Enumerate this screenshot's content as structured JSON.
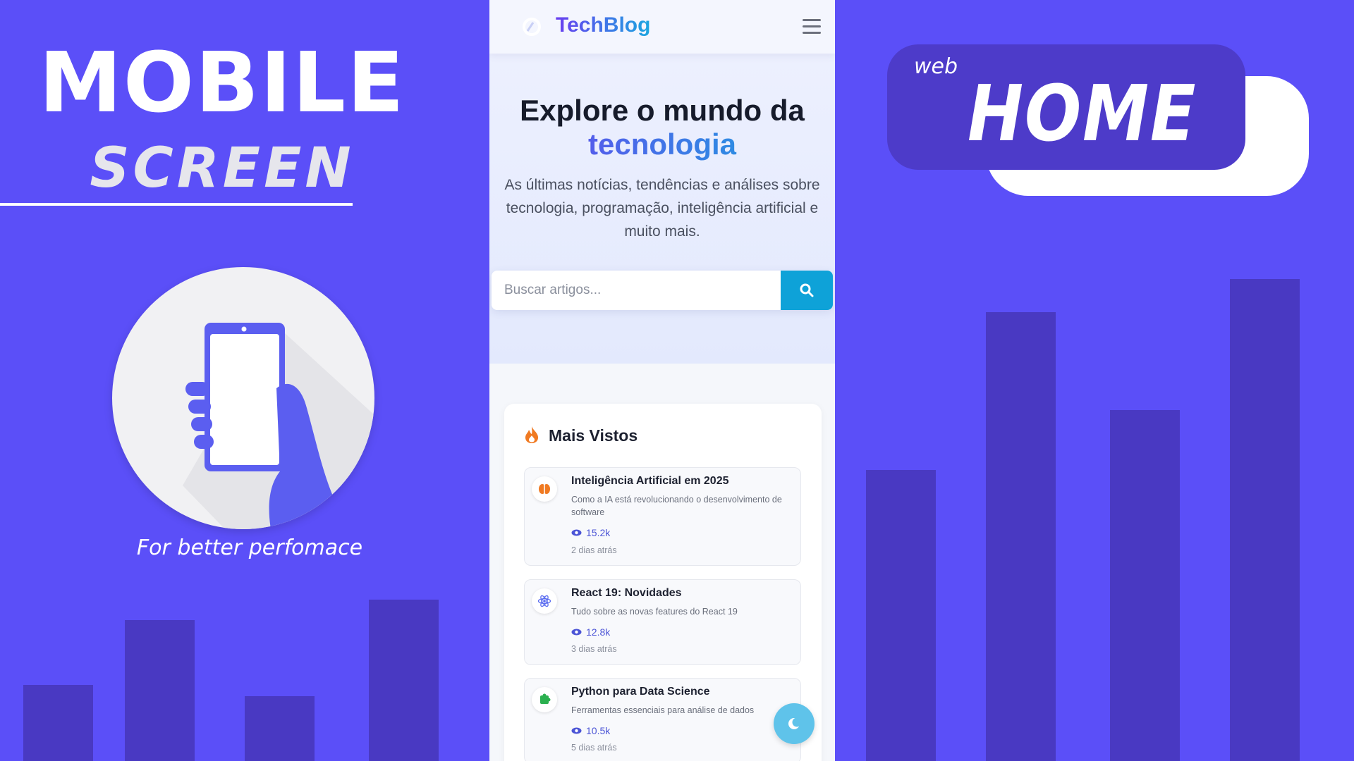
{
  "promo": {
    "mobile_label": "MOBILE",
    "screen_label": "SCREEN",
    "tagline": "For better perfomace",
    "badge_small": "web",
    "badge_large": "HOME",
    "colors": {
      "background": "#5b4ff8",
      "bars": "#4939c2",
      "badge": "#4d3bc9"
    },
    "illustration": "hand-holding-phone-icon"
  },
  "app": {
    "brand": "TechBlog",
    "logo_icon": "logo-icon",
    "menu_icon": "hamburger-menu-icon",
    "hero": {
      "title_line1": "Explore o mundo da",
      "title_highlight": "tecnologia",
      "description": "As últimas notícias, tendências e análises sobre tecnologia, programação, inteligência artificial e muito mais."
    },
    "search": {
      "placeholder": "Buscar artigos...",
      "button_icon": "search-icon"
    },
    "most_viewed": {
      "title": "Mais Vistos",
      "icon": "fire-icon",
      "articles": [
        {
          "title": "Inteligência Artificial em 2025",
          "description": "Como a IA está revolucionando o desenvolvimento de software",
          "views": "15.2k",
          "time": "2 dias atrás",
          "icon": "brain-icon"
        },
        {
          "title": "React 19: Novidades",
          "description": "Tudo sobre as novas features do React 19",
          "views": "12.8k",
          "time": "3 dias atrás",
          "icon": "react-atom-icon"
        },
        {
          "title": "Python para Data Science",
          "description": "Ferramentas essenciais para análise de dados",
          "views": "10.5k",
          "time": "5 dias atrás",
          "icon": "puzzle-icon"
        }
      ]
    },
    "theme_toggle_icon": "moon-icon",
    "colors": {
      "accent": "#0ea2d8",
      "brand_start": "#6a3ff0",
      "brand_end": "#1ba6e0",
      "views": "#4c55d6"
    }
  }
}
